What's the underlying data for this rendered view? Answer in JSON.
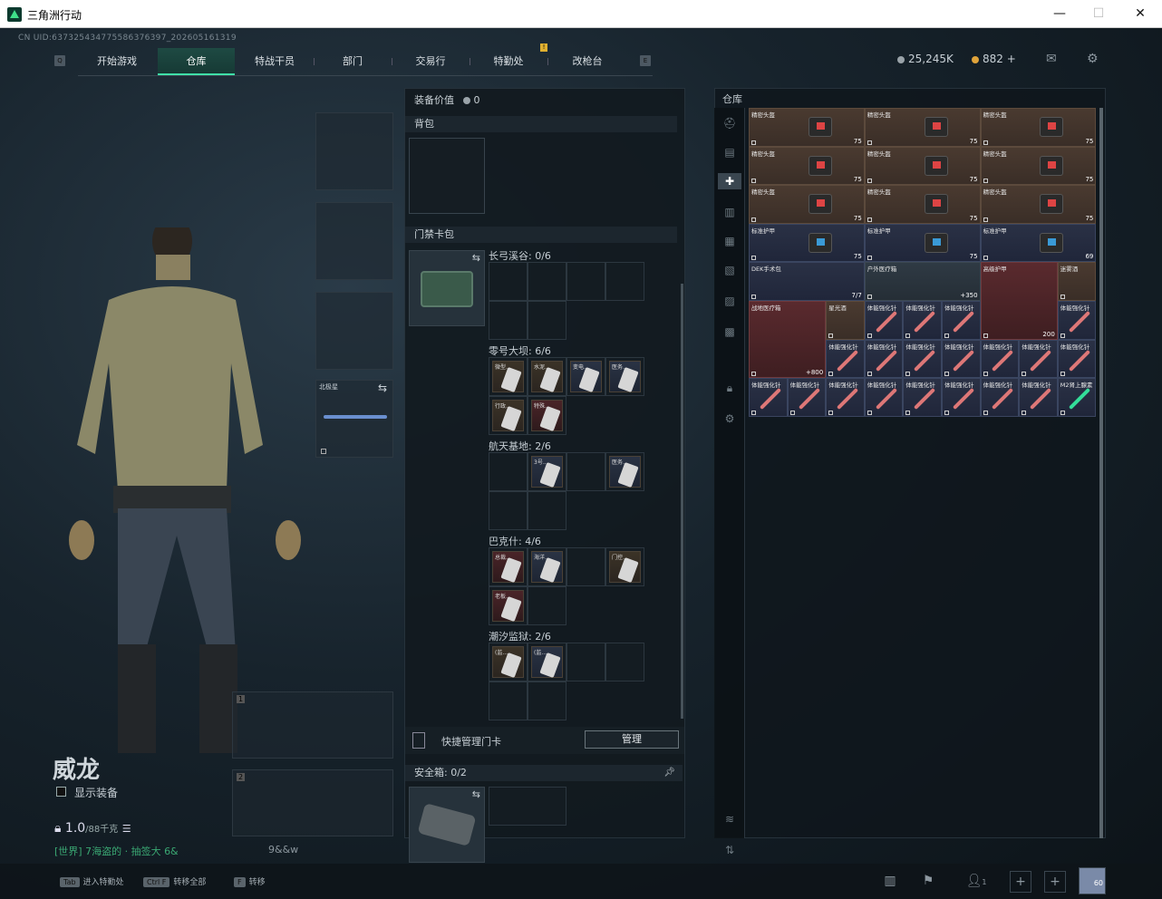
{
  "window": {
    "title": "三角洲行动"
  },
  "uid": "CN UID:637325434775586376397_202605161319",
  "nav": {
    "tabs": [
      "开始游戏",
      "仓库",
      "特战干员",
      "部门",
      "交易行",
      "特勤处",
      "改枪台"
    ],
    "active": 1,
    "left_key": "Q",
    "right_key": "E",
    "badge": "!"
  },
  "currency": {
    "coins": "25,245K",
    "bonds": "882",
    "plus": "+"
  },
  "operator": {
    "name": "威龙",
    "show_equip": "显示装备",
    "weight": "1.0",
    "weight_max": "/88千克",
    "chat": "[世界] 7海盗的 · 抽签大 6&",
    "chat2": "9&&w",
    "slot1": "1",
    "slot2": "2",
    "melee": "北极星"
  },
  "mid": {
    "equip_value": "装备价值",
    "equip_value_num": "0",
    "backpack": "背包",
    "keycard_pack": "门禁卡包",
    "maps": [
      {
        "name": "长弓溪谷: 0/6"
      },
      {
        "name": "零号大坝: 6/6",
        "cards": [
          "微型...",
          "水泥...",
          "变电...",
          "医务...",
          "行政...",
          "特殊..."
        ]
      },
      {
        "name": "航天基地: 2/6",
        "cards": [
          "3号...",
          "医务..."
        ]
      },
      {
        "name": "巴克什: 4/6",
        "cards": [
          "总裁...",
          "海洋...",
          "门控...",
          "老板..."
        ]
      },
      {
        "name": "潮汐监狱: 2/6",
        "cards": [
          "(监...",
          "(监..."
        ]
      }
    ],
    "quick_manage": "快捷管理门卡",
    "manage": "管理",
    "safe_box": "安全箱:",
    "safe_box_count": "0/2"
  },
  "warehouse": {
    "title": "仓库",
    "rows": [
      {
        "items": [
          {
            "name": "精密头盔",
            "qty": "75",
            "cls": "brown",
            "kind": "bag"
          },
          {
            "name": "精密头盔",
            "qty": "75",
            "cls": "brown",
            "kind": "bag"
          },
          {
            "name": "精密头盔",
            "qty": "75",
            "cls": "brown",
            "kind": "bag"
          }
        ]
      },
      {
        "items": [
          {
            "name": "精密头盔",
            "qty": "75",
            "cls": "brown",
            "kind": "bag"
          },
          {
            "name": "精密头盔",
            "qty": "75",
            "cls": "brown",
            "kind": "bag"
          },
          {
            "name": "精密头盔",
            "qty": "75",
            "cls": "brown",
            "kind": "bag"
          }
        ]
      },
      {
        "items": [
          {
            "name": "精密头盔",
            "qty": "75",
            "cls": "brown",
            "kind": "bag"
          },
          {
            "name": "精密头盔",
            "qty": "75",
            "cls": "brown",
            "kind": "bag"
          },
          {
            "name": "精密头盔",
            "qty": "75",
            "cls": "brown",
            "kind": "bag"
          }
        ]
      },
      {
        "items": [
          {
            "name": "标准护甲",
            "qty": "75",
            "cls": "navy",
            "kind": "vest"
          },
          {
            "name": "标准护甲",
            "qty": "75",
            "cls": "navy",
            "kind": "vest"
          },
          {
            "name": "标准护甲",
            "qty": "69",
            "cls": "navy",
            "kind": "vest"
          }
        ]
      }
    ],
    "row5": [
      {
        "name": "DEK手术包",
        "qty": "7/7"
      },
      {
        "name": "户外医疗箱",
        "qty": "+350"
      },
      {
        "name": "高级护甲",
        "qty": "200"
      },
      {
        "name": "迷雾酒",
        "qty": ""
      }
    ],
    "row6": {
      "big": {
        "name": "战地医疗箱",
        "qty": "+800"
      },
      "small": {
        "name": "星光酒",
        "qty": ""
      }
    },
    "syringe_name": "体能强化针",
    "syringe_last": "M2肾上腺素"
  },
  "bottom": {
    "keys": [
      {
        "key": "Tab",
        "label": "进入特勤处"
      },
      {
        "key": "Ctrl F",
        "label": "转移全部"
      },
      {
        "key": "F",
        "label": "转移"
      }
    ],
    "friends": "1",
    "level": "60"
  }
}
